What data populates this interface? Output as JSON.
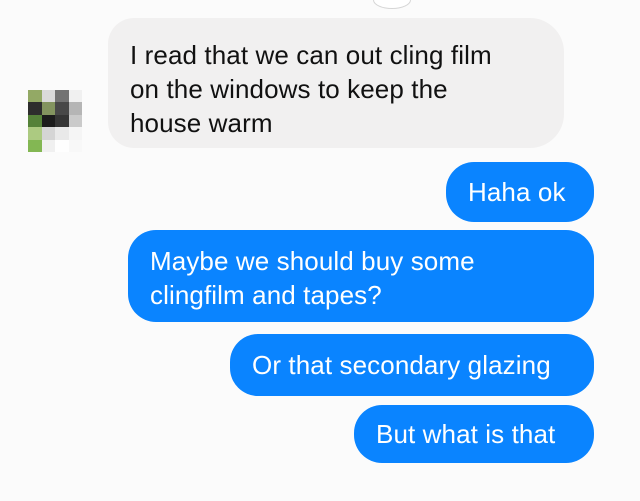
{
  "conversation": {
    "messages": [
      {
        "sender": "other",
        "text": "I read that we can out cling film\non the windows to keep the\nhouse warm"
      },
      {
        "sender": "me",
        "text": "Haha ok"
      },
      {
        "sender": "me",
        "text": "Maybe we should buy some\nclingfilm and tapes?"
      },
      {
        "sender": "me",
        "text": "Or that secondary glazing"
      },
      {
        "sender": "me",
        "text": "But what is that"
      }
    ]
  },
  "colors": {
    "background": "#fbfbfb",
    "incoming_bubble": "#f1f0f0",
    "outgoing_bubble": "#0a84ff",
    "incoming_text": "#111111",
    "outgoing_text": "#ffffff"
  }
}
